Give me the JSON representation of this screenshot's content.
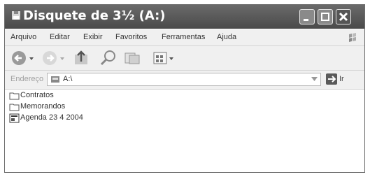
{
  "window": {
    "title": "Disquete de 3½ (A:)"
  },
  "menubar": {
    "items": [
      "Arquivo",
      "Editar",
      "Exibir",
      "Favoritos",
      "Ferramentas",
      "Ajuda"
    ]
  },
  "toolbar": {
    "icons": [
      "back-icon",
      "forward-icon",
      "up-folder-icon",
      "search-icon",
      "folders-icon",
      "views-icon"
    ]
  },
  "addressbar": {
    "label": "Endereço",
    "value": "A:\\",
    "go_label": "Ir"
  },
  "files": [
    {
      "name": "Contratos",
      "icon": "folder-icon"
    },
    {
      "name": "Memorandos",
      "icon": "folder-icon"
    },
    {
      "name": "Agenda 23 4 2004",
      "icon": "document-icon"
    }
  ]
}
